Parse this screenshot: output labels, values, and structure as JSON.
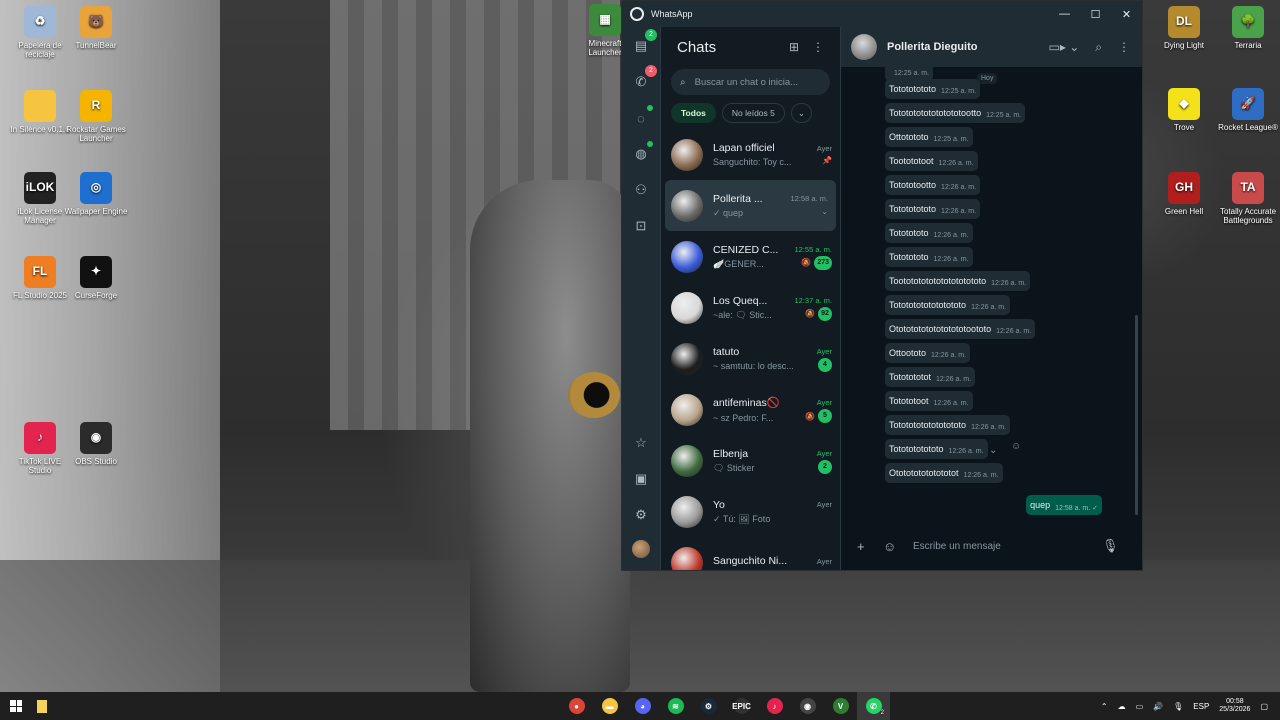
{
  "desktop_icons_left": [
    {
      "label": "Papelera de reciclaje",
      "icon": "recycle-bin-icon",
      "color": "#9fb8d8",
      "glyph": "♻"
    },
    {
      "label": "TunnelBear",
      "icon": "tunnelbear-icon",
      "color": "#e8a33a",
      "glyph": "🐻"
    },
    {
      "label": "In Silence v0.1.6",
      "icon": "folder-icon",
      "color": "#f5c542",
      "glyph": ""
    },
    {
      "label": "Rockstar Games Launcher",
      "icon": "rockstar-icon",
      "color": "#f4b400",
      "glyph": "R"
    },
    {
      "label": "iLok License Manager",
      "icon": "ilok-icon",
      "color": "#222222",
      "glyph": "iLOK"
    },
    {
      "label": "Wallpaper Engine",
      "icon": "wallpaper-engine-icon",
      "color": "#1f6fd1",
      "glyph": "◎"
    },
    {
      "label": "FL Studio 2025",
      "icon": "fl-studio-icon",
      "color": "#ef7d22",
      "glyph": "FL"
    },
    {
      "label": "CurseForge",
      "icon": "curseforge-icon",
      "color": "#111111",
      "glyph": "✦"
    },
    {
      "label": "TikTok LIVE Studio",
      "icon": "tiktok-live-icon",
      "color": "#e3244f",
      "glyph": "♪"
    },
    {
      "label": "OBS Studio",
      "icon": "obs-icon",
      "color": "#2b2b2b",
      "glyph": "◉"
    }
  ],
  "desktop_icons_right": [
    {
      "label": "Minecraft Launcher",
      "icon": "minecraft-icon",
      "color": "#3d8a3d",
      "glyph": "▦"
    },
    {
      "label": "Dying Light",
      "icon": "dying-light-icon",
      "color": "#b58a2c",
      "glyph": "DL"
    },
    {
      "label": "Terraria",
      "icon": "terraria-icon",
      "color": "#4aa34a",
      "glyph": "🌳"
    },
    {
      "label": "Trove",
      "icon": "trove-icon",
      "color": "#f3e21a",
      "glyph": "◆"
    },
    {
      "label": "Rocket League®",
      "icon": "rocket-league-icon",
      "color": "#2f6cc4",
      "glyph": "🚀"
    },
    {
      "label": "Green Hell",
      "icon": "green-hell-icon",
      "color": "#b01e1e",
      "glyph": "GH"
    },
    {
      "label": "Totally Accurate Battlegrounds",
      "icon": "tabg-icon",
      "color": "#c94a4a",
      "glyph": "TA"
    }
  ],
  "window": {
    "title": "WhatsApp",
    "minimize": "—",
    "maximize": "☐",
    "close": "✕"
  },
  "rail": {
    "chats_badge": "2",
    "calls_badge": "2",
    "badge_colors": {
      "chats": "#21c063",
      "calls": "#f15c6d"
    }
  },
  "chatlist": {
    "title": "Chats",
    "search_placeholder": "Buscar un chat o inicia...",
    "filters": [
      "Todos",
      "No leídos 5"
    ],
    "filter_more": "⌄",
    "items": [
      {
        "name": "Lapan officiel",
        "time": "Ayer",
        "preview": "Sanguchito: Toy c...",
        "unread": "",
        "muted": false,
        "pinned": true,
        "time_unread": false,
        "avatar": "#8b6b52"
      },
      {
        "name": "Pollerita ...",
        "time": "12:58 a. m.",
        "preview": "✓ quep",
        "unread": "",
        "muted": false,
        "pinned": false,
        "time_unread": false,
        "avatar": "#6a6a6a"
      },
      {
        "name": "CENIZED C...",
        "time": "12:55 a. m.",
        "preview": "🪽GENER...",
        "unread": "273",
        "muted": true,
        "pinned": false,
        "time_unread": true,
        "avatar": "#3a5bd9"
      },
      {
        "name": "Los Queq...",
        "time": "12:37 a. m.",
        "preview": "~ale: 🗨 Stic...",
        "unread": "92",
        "muted": true,
        "pinned": false,
        "time_unread": true,
        "avatar": "#d8d8d8"
      },
      {
        "name": "tatuto",
        "time": "Ayer",
        "preview": "~ samtutu: lo desc...",
        "unread": "4",
        "muted": false,
        "pinned": false,
        "time_unread": true,
        "avatar": "#1d1d1d"
      },
      {
        "name": "antifeminas🚫",
        "time": "Ayer",
        "preview": "~ sz Pedro: F...",
        "unread": "5",
        "muted": true,
        "pinned": false,
        "time_unread": true,
        "avatar": "#b8a48a"
      },
      {
        "name": "Elbenja",
        "time": "Ayer",
        "preview": "🗨 Sticker",
        "unread": "2",
        "muted": false,
        "pinned": false,
        "time_unread": true,
        "avatar": "#3f6b3f"
      },
      {
        "name": "Yo",
        "time": "Ayer",
        "preview": "✓ Tú: 🖼 Foto",
        "unread": "",
        "muted": false,
        "pinned": false,
        "time_unread": false,
        "avatar": "#9a9a9a"
      },
      {
        "name": "Sanguchito Ni...",
        "time": "Ayer",
        "preview": "",
        "unread": "",
        "muted": false,
        "pinned": false,
        "time_unread": false,
        "avatar": "#c0392b"
      }
    ]
  },
  "conversation": {
    "contact_name": "Pollerita Dieguito",
    "day_label": "Hoy",
    "composer_placeholder": "Escribe un mensaje",
    "messages": [
      {
        "text": "",
        "time": "12:25 a. m.",
        "out": false
      },
      {
        "text": "Totototototo",
        "time": "12:25 a. m.",
        "out": false
      },
      {
        "text": "Totototototototototootto",
        "time": "12:25 a. m.",
        "out": false
      },
      {
        "text": "Ottotototo",
        "time": "12:25 a. m.",
        "out": false
      },
      {
        "text": "Tootototoot",
        "time": "12:26 a. m.",
        "out": false
      },
      {
        "text": "Totototootto",
        "time": "12:26 a. m.",
        "out": false
      },
      {
        "text": "Totototototo",
        "time": "12:26 a. m.",
        "out": false
      },
      {
        "text": "Tototototo",
        "time": "12:26 a. m.",
        "out": false
      },
      {
        "text": "Tototototo",
        "time": "12:26 a. m.",
        "out": false
      },
      {
        "text": "Tootototototototototototo",
        "time": "12:26 a. m.",
        "out": false
      },
      {
        "text": "Totototototototototo",
        "time": "12:26 a. m.",
        "out": false
      },
      {
        "text": "Ototototototototototoototo",
        "time": "12:26 a. m.",
        "out": false
      },
      {
        "text": "Ottoototo",
        "time": "12:26 a. m.",
        "out": false
      },
      {
        "text": "Tototototot",
        "time": "12:26 a. m.",
        "out": false
      },
      {
        "text": "Totototoot",
        "time": "12:26 a. m.",
        "out": false
      },
      {
        "text": "Totototototototototo",
        "time": "12:26 a. m.",
        "out": false
      },
      {
        "text": "Tototototototo",
        "time": "12:26 a. m.",
        "out": false
      },
      {
        "text": "Ototototototototot",
        "time": "12:26 a. m.",
        "out": false
      },
      {
        "text": "quep",
        "time": "12:58 a. m. ✓",
        "out": true
      }
    ]
  },
  "taskbar": {
    "apps": [
      {
        "name": "chrome-icon",
        "glyph": "●",
        "color": "#db4437"
      },
      {
        "name": "file-explorer-icon",
        "glyph": "▬",
        "color": "#f5c542"
      },
      {
        "name": "discord-icon",
        "glyph": "◕",
        "color": "#5865f2"
      },
      {
        "name": "spotify-icon",
        "glyph": "≋",
        "color": "#1db954"
      },
      {
        "name": "steam-icon",
        "glyph": "⚙",
        "color": "#1b2838"
      },
      {
        "name": "epic-games-icon",
        "glyph": "EPIC",
        "color": "#313131"
      },
      {
        "name": "tiktok-icon",
        "glyph": "♪",
        "color": "#e3244f"
      },
      {
        "name": "obs-taskbar-icon",
        "glyph": "◉",
        "color": "#444444"
      },
      {
        "name": "vegas-icon",
        "glyph": "V",
        "color": "#2f7d32"
      },
      {
        "name": "whatsapp-taskbar-icon",
        "glyph": "✆",
        "color": "#25d366",
        "count": "2",
        "active": true
      }
    ],
    "language": "ESP",
    "time": "00:58",
    "date": "25/3/2026"
  }
}
